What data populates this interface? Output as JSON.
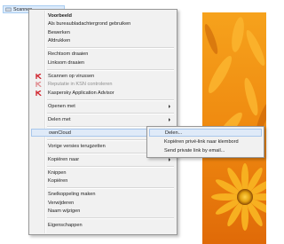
{
  "explorer": {
    "item_label": "Scannen"
  },
  "context_menu": {
    "items": [
      {
        "label": "Voorbeeld"
      },
      {
        "label": "Als bureaubladachtergrond gebruiken"
      },
      {
        "label": "Bewerken"
      },
      {
        "label": "Afdrukken"
      },
      {
        "label": "Rechtsom draaien"
      },
      {
        "label": "Linksom draaien"
      },
      {
        "label": "Scannen op virussen"
      },
      {
        "label": "Reputatie in KSN controleren"
      },
      {
        "label": "Kaspersky Application Advisor"
      },
      {
        "label": "Openen met"
      },
      {
        "label": "Delen met"
      },
      {
        "label": "ownCloud"
      },
      {
        "label": "Vorige versies terugzetten"
      },
      {
        "label": "Kopiëren naar"
      },
      {
        "label": "Knippen"
      },
      {
        "label": "Kopiëren"
      },
      {
        "label": "Snelkoppeling maken"
      },
      {
        "label": "Verwijderen"
      },
      {
        "label": "Naam wijzigen"
      },
      {
        "label": "Eigenschappen"
      }
    ]
  },
  "owncloud_submenu": {
    "items": [
      {
        "label": "Delen..."
      },
      {
        "label": "Kopiëren privé-link naar klembord"
      },
      {
        "label": "Send private link by email..."
      }
    ]
  },
  "colors": {
    "highlight": "#dfeaf8",
    "menu_background": "#f1f1f1",
    "kaspersky_red": "#d0202a",
    "photo_orange": "#f08a12"
  }
}
